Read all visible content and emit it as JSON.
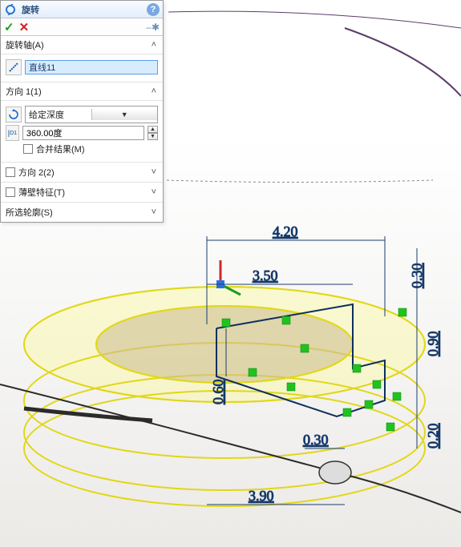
{
  "panel": {
    "title": "旋转",
    "help_tip": "?",
    "ok": "✓",
    "cancel": "✕",
    "pin": "–✱"
  },
  "axis": {
    "header": "旋转轴(A)",
    "value": "直线11"
  },
  "dir1": {
    "header": "方向 1(1)",
    "end_condition": "给定深度",
    "angle_label": "D1",
    "angle_value": "360.00度",
    "merge_label": "合并结果(M)"
  },
  "dir2": {
    "header": "方向 2(2)"
  },
  "thin": {
    "header": "薄壁特征(T)"
  },
  "contours": {
    "header": "所选轮廓(S)"
  },
  "dims": {
    "d1": "4.20",
    "d2": "3.50",
    "d3": "0.60",
    "d4": "0.30",
    "d5": "3.90",
    "d6": "0.30",
    "d7": "0.90",
    "d8": "0.20"
  }
}
